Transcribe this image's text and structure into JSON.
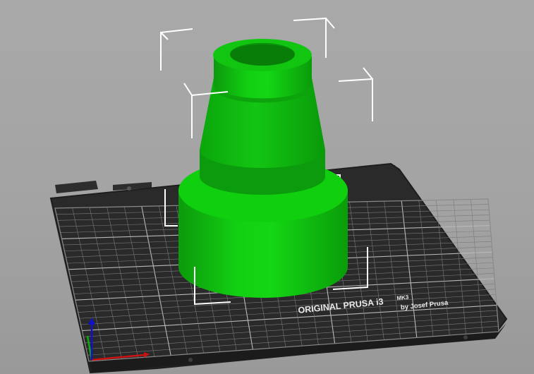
{
  "viewport": {
    "background_color": "#a6a6a6"
  },
  "bed": {
    "brand_line": "ORIGINAL PRUSA i3",
    "model_label": "MK3",
    "byline": "by Josef Prusa",
    "plate_color": "#2b2b2b",
    "grid_color": "#7a7a7a"
  },
  "model": {
    "shape": "stepped-cylinder-adapter",
    "color": "#10c510",
    "selected": true
  },
  "selection_box": {
    "color": "#ffffff"
  },
  "axes": {
    "x_color": "#cc1111",
    "y_color": "#11aa11",
    "z_color": "#1111cc"
  }
}
